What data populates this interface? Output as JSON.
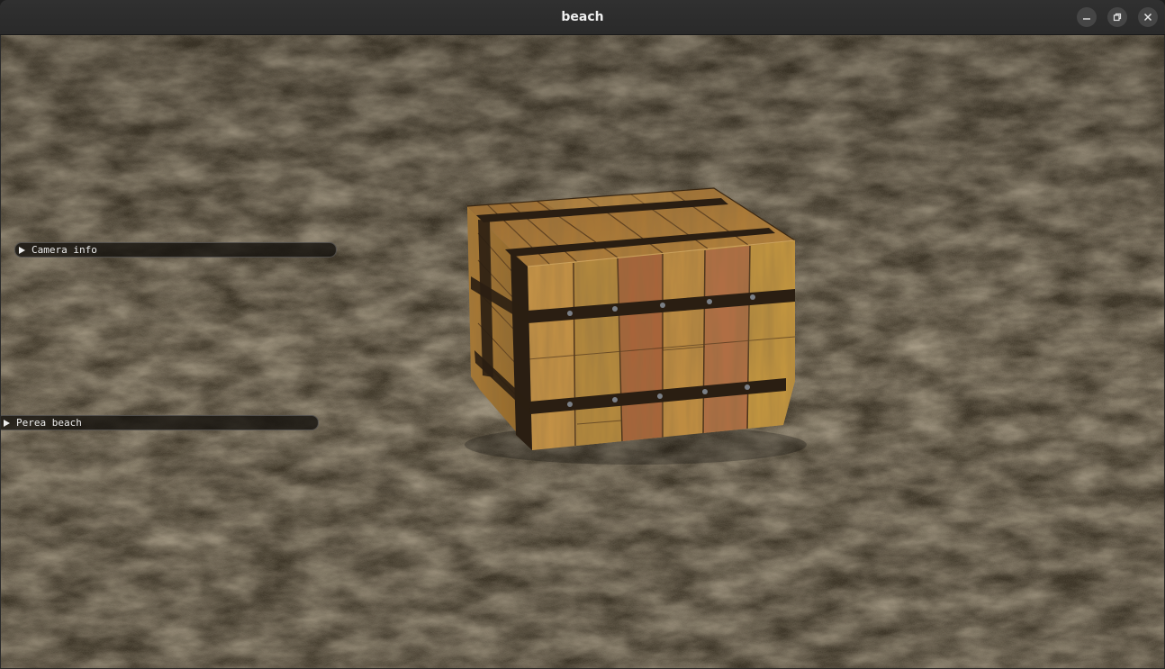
{
  "window": {
    "title": "beach",
    "controls": [
      "minimize-icon",
      "restore-icon",
      "close-icon"
    ]
  },
  "overlay": {
    "panels": [
      {
        "label": "Camera info",
        "expanded": false
      },
      {
        "label": "Perea beach",
        "expanded": false
      }
    ]
  },
  "scene": {
    "ground": "sand",
    "object": "wooden-crate"
  },
  "colors": {
    "titlebar": "#2d2d2d",
    "sand_dark": "#2c2619",
    "sand_light": "#6e5f45",
    "wood_light": "#b8893f",
    "wood_red": "#a8643a",
    "iron_band": "#2a1e12"
  }
}
